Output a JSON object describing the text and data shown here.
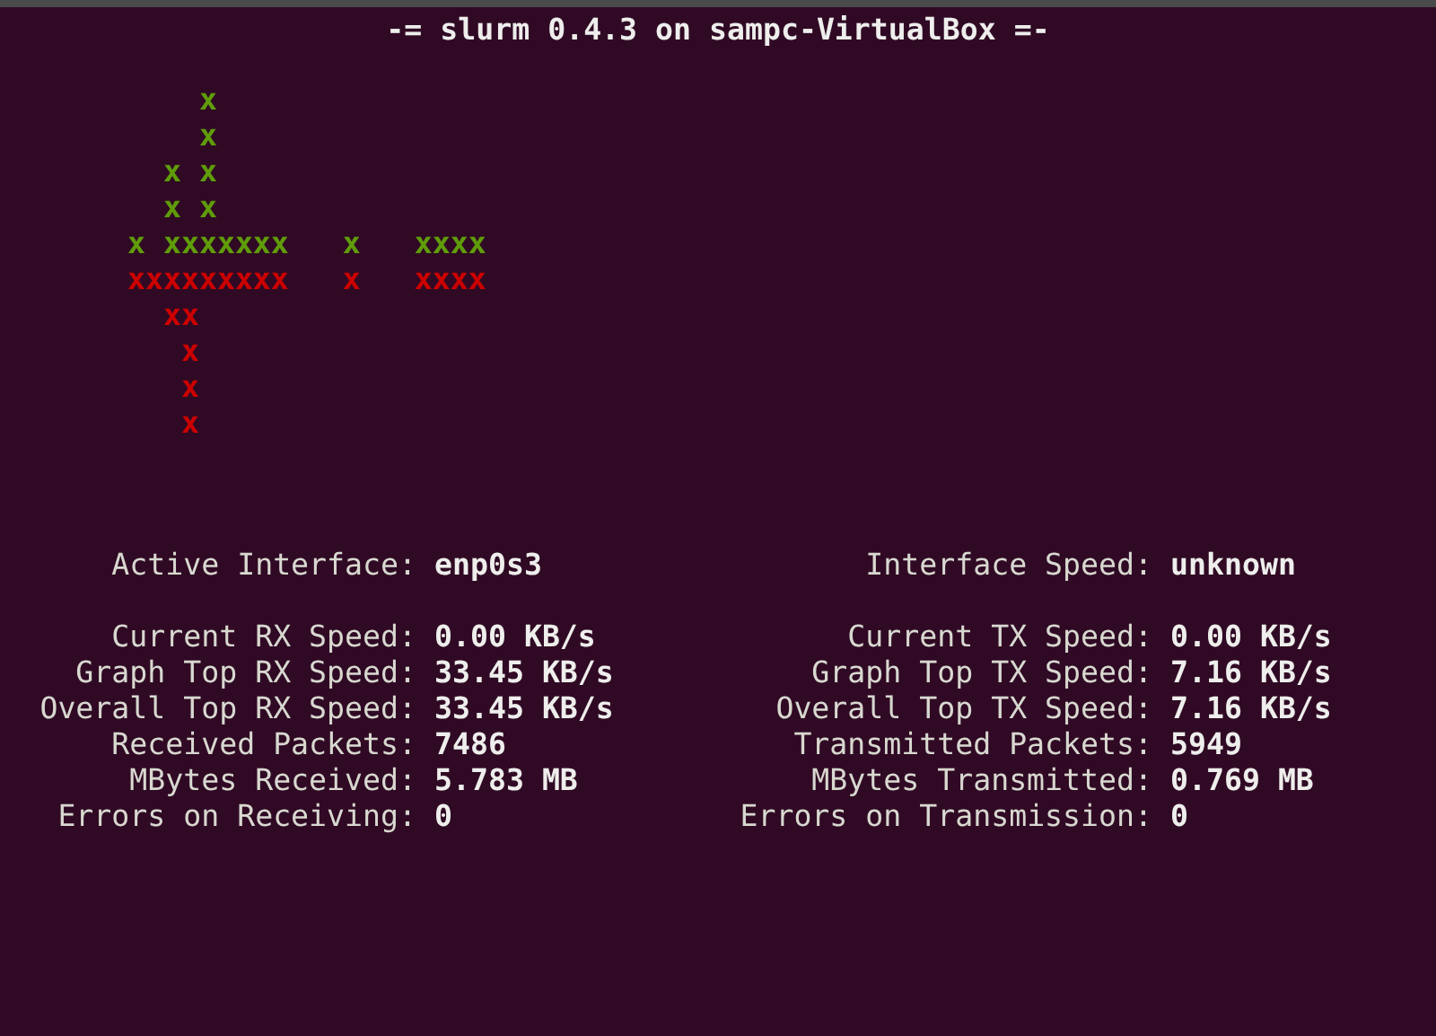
{
  "window": {
    "title": "-= slurm 0.4.3 on sampc-VirtualBox =-"
  },
  "graph": {
    "lines": [
      {
        "text": "    x",
        "color": "#5f9c0a"
      },
      {
        "text": "    x",
        "color": "#5f9c0a"
      },
      {
        "text": "  x x",
        "color": "#5f9c0a"
      },
      {
        "text": "  x x",
        "color": "#5f9c0a"
      },
      {
        "text": "x xxxxxxx   x   xxxx",
        "color": "#5f9c0a"
      },
      {
        "text": "xxxxxxxxx   x   xxxx",
        "color": "#cc0000"
      },
      {
        "text": "  xx",
        "color": "#cc0000"
      },
      {
        "text": "   x",
        "color": "#cc0000"
      },
      {
        "text": "   x",
        "color": "#cc0000"
      },
      {
        "text": "   x",
        "color": "#cc0000"
      }
    ]
  },
  "stats": {
    "left": {
      "interface": {
        "label": "Active Interface:",
        "value": "enp0s3"
      },
      "rows": [
        {
          "label": "Current RX Speed:",
          "value": "0.00 KB/s"
        },
        {
          "label": "Graph Top RX Speed:",
          "value": "33.45 KB/s"
        },
        {
          "label": "Overall Top RX Speed:",
          "value": "33.45 KB/s"
        },
        {
          "label": "Received Packets:",
          "value": "7486"
        },
        {
          "label": "MBytes Received:",
          "value": "5.783 MB"
        },
        {
          "label": "Errors on Receiving:",
          "value": "0"
        }
      ]
    },
    "right": {
      "interface": {
        "label": "Interface Speed:",
        "value": "unknown"
      },
      "rows": [
        {
          "label": "Current TX Speed:",
          "value": "0.00 KB/s"
        },
        {
          "label": "Graph Top TX Speed:",
          "value": "7.16 KB/s"
        },
        {
          "label": "Overall Top TX Speed:",
          "value": "7.16 KB/s"
        },
        {
          "label": "Transmitted Packets:",
          "value": "5949"
        },
        {
          "label": "MBytes Transmitted:",
          "value": "0.769 MB"
        },
        {
          "label": "Errors on Transmission:",
          "value": "0"
        }
      ]
    }
  }
}
